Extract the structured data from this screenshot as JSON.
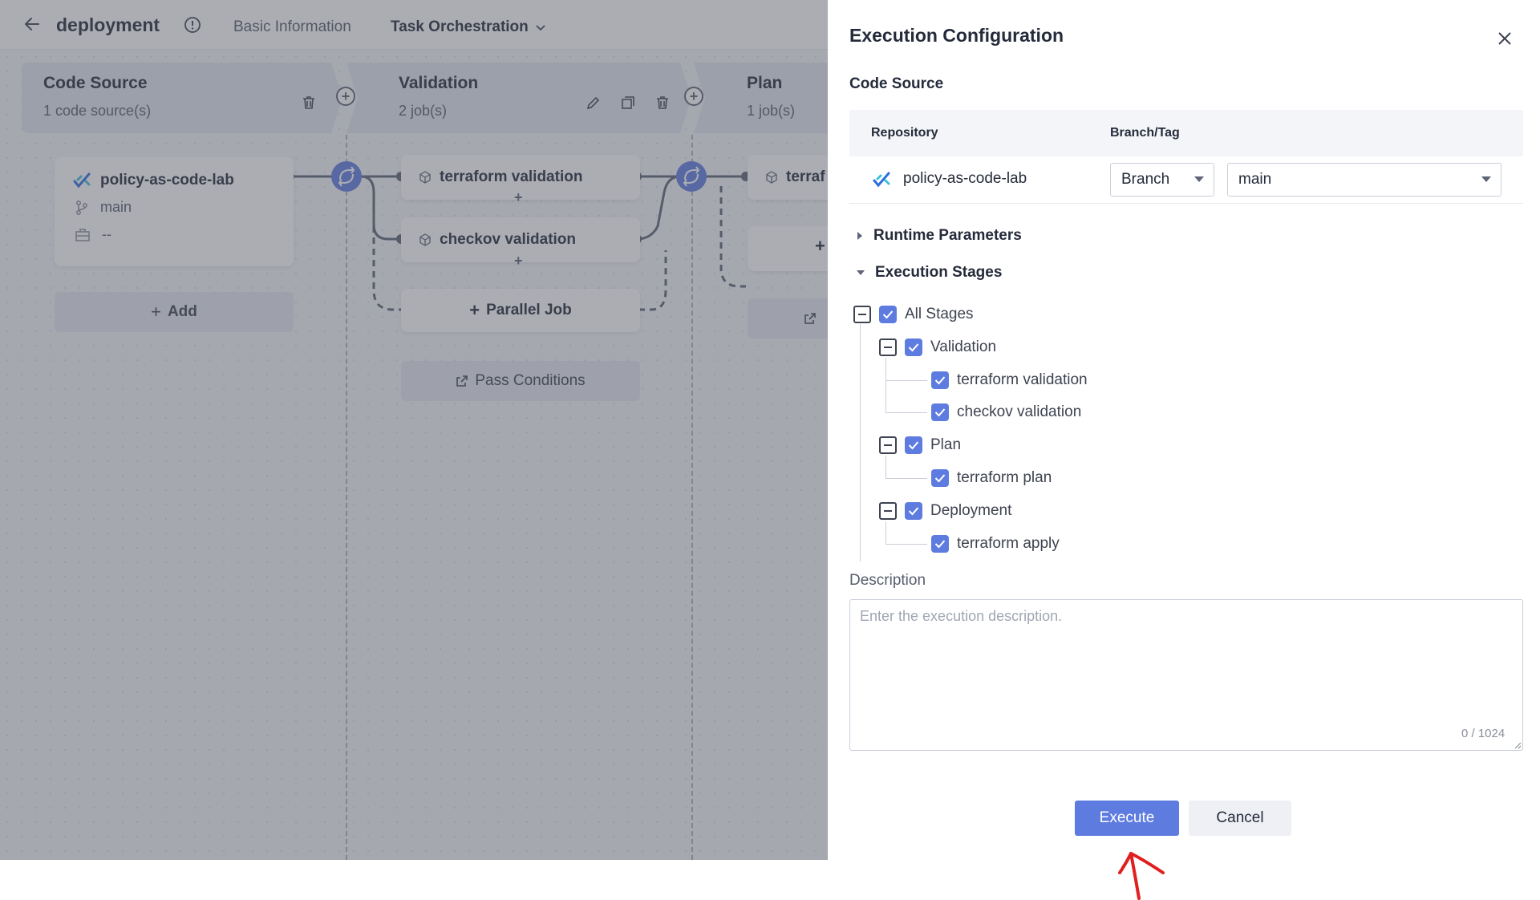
{
  "header": {
    "title": "deployment",
    "tabs": [
      "Basic Information",
      "Task Orchestration"
    ]
  },
  "pipeline": {
    "stages": [
      {
        "name": "Code Source",
        "count": "1 code source(s)"
      },
      {
        "name": "Validation",
        "count": "2 job(s)"
      },
      {
        "name": "Plan",
        "count": "1 job(s)"
      }
    ],
    "code_source_card": {
      "repo": "policy-as-code-lab",
      "branch": "main",
      "tag": "--"
    },
    "add_label": "Add",
    "validation_jobs": [
      "terraform validation",
      "checkov validation"
    ],
    "parallel_job_label": "Parallel Job",
    "pass_conditions_label": "Pass Conditions",
    "plan_job_partial": "terraf"
  },
  "drawer": {
    "title": "Execution Configuration",
    "code_source_label": "Code Source",
    "table_headers": {
      "repository": "Repository",
      "branch_tag": "Branch/Tag"
    },
    "repo_name": "policy-as-code-lab",
    "ref_type": "Branch",
    "ref_value": "main",
    "runtime_params_label": "Runtime Parameters",
    "execution_stages_label": "Execution Stages",
    "tree": {
      "all": "All Stages",
      "stages": [
        {
          "name": "Validation",
          "jobs": [
            "terraform validation",
            "checkov validation"
          ]
        },
        {
          "name": "Plan",
          "jobs": [
            "terraform plan"
          ]
        },
        {
          "name": "Deployment",
          "jobs": [
            "terraform apply"
          ]
        }
      ]
    },
    "description_label": "Description",
    "description_placeholder": "Enter the execution description.",
    "description_value": "",
    "counter": "0 / 1024",
    "execute_label": "Execute",
    "cancel_label": "Cancel"
  },
  "colors": {
    "accent": "#5e7ce0",
    "mask": "#50546080",
    "annotation": "#e02020"
  }
}
